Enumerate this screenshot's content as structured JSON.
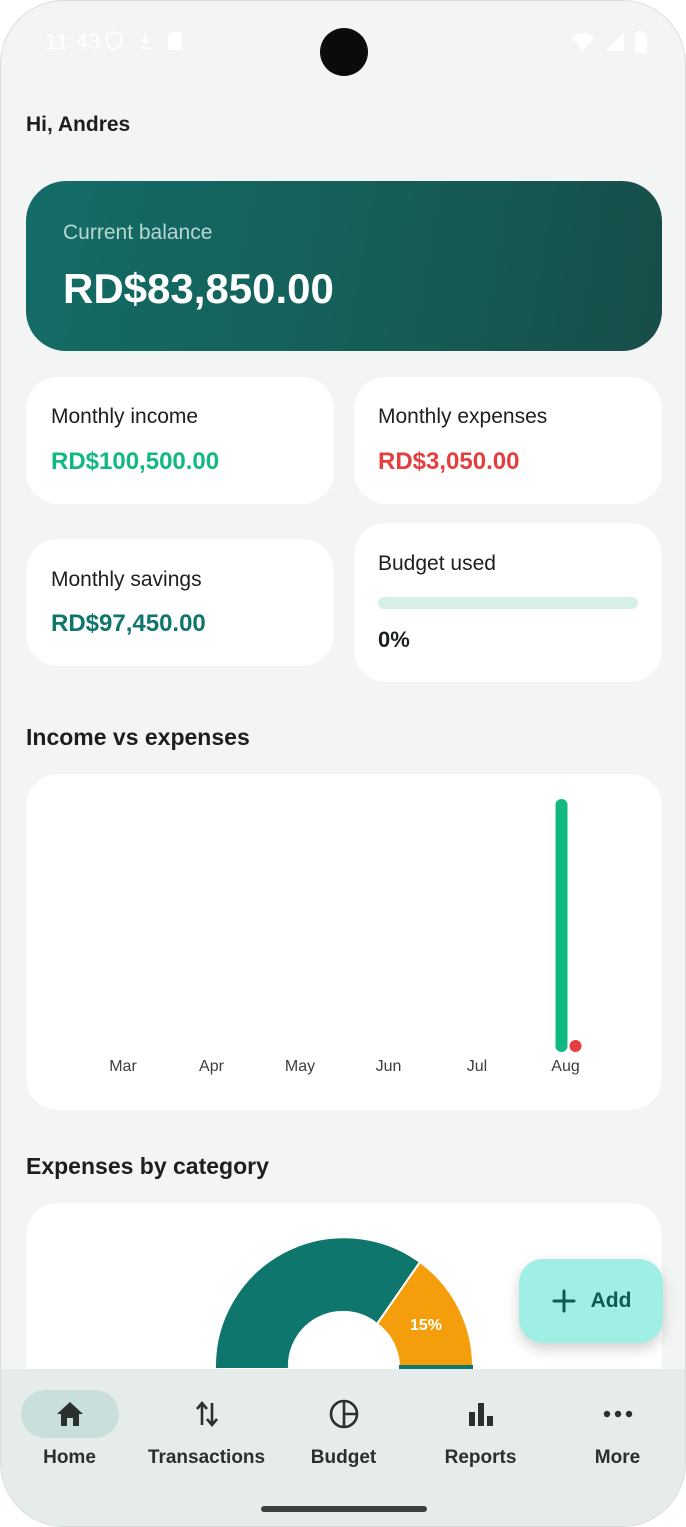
{
  "status_bar": {
    "time": "11:43"
  },
  "greeting": "Hi, Andres",
  "balance": {
    "label": "Current balance",
    "value": "RD$83,850.00"
  },
  "summary": {
    "income": {
      "label": "Monthly income",
      "value": "RD$100,500.00"
    },
    "expenses": {
      "label": "Monthly expenses",
      "value": "RD$3,050.00"
    },
    "savings": {
      "label": "Monthly savings",
      "value": "RD$97,450.00"
    },
    "budget": {
      "label": "Budget used",
      "value": "0%",
      "fraction": 0
    }
  },
  "income_vs_expenses": {
    "title": "Income vs expenses"
  },
  "expenses_by_category": {
    "title": "Expenses by category",
    "slice_label": "15%"
  },
  "fab": {
    "label": "Add"
  },
  "nav": {
    "items": [
      {
        "label": "Home",
        "icon": "home-icon"
      },
      {
        "label": "Transactions",
        "icon": "swap-vertical-icon"
      },
      {
        "label": "Budget",
        "icon": "pie-chart-icon"
      },
      {
        "label": "Reports",
        "icon": "bar-chart-icon"
      },
      {
        "label": "More",
        "icon": "more-horizontal-icon"
      }
    ]
  },
  "colors": {
    "accent": "#146c66",
    "income": "#10b981",
    "expense": "#e53e3e",
    "savings": "#0f766e",
    "category_orange": "#f59e0b"
  },
  "chart_data": {
    "type": "bar",
    "categories": [
      "Mar",
      "Apr",
      "May",
      "Jun",
      "Jul",
      "Aug"
    ],
    "series": [
      {
        "values": [
          0,
          0,
          0,
          0,
          0,
          100500
        ]
      },
      {
        "values": [
          0,
          0,
          0,
          0,
          0,
          3050
        ]
      }
    ],
    "title": "Income vs expenses",
    "xlabel": "",
    "ylabel": "",
    "ylim": [
      0,
      100500
    ],
    "grid": false
  }
}
